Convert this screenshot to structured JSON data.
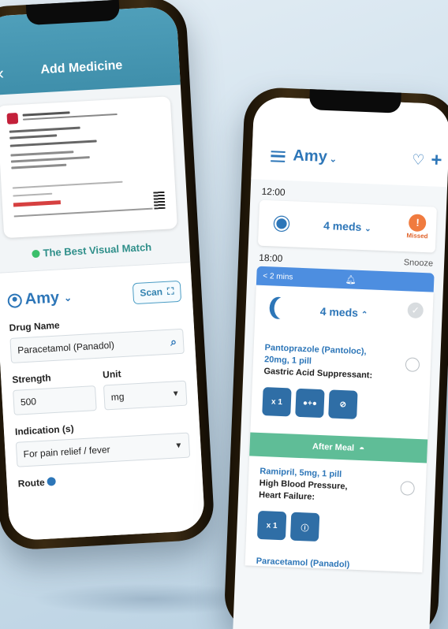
{
  "left_phone": {
    "header": {
      "back_icon": "chevron-left-icon",
      "title": "Add Medicine"
    },
    "match_label": "The Best Visual Match",
    "form": {
      "user_name": "Amy",
      "scan_label": "Scan",
      "drug_name_label": "Drug Name",
      "drug_name_value": "Paracetamol (Panadol)",
      "strength_label": "Strength",
      "strength_value": "500",
      "unit_label": "Unit",
      "unit_value": "mg",
      "indication_label": "Indication (s)",
      "indication_value": "For pain relief / fever",
      "route_label": "Route"
    }
  },
  "right_phone": {
    "header": {
      "user_name": "Amy",
      "plus_label": "+"
    },
    "slots": [
      {
        "time": "12:00",
        "meds_label": "4 meds",
        "status": "Missed",
        "status_symbol": "!"
      },
      {
        "time": "18:00",
        "snooze_label": "Snooze",
        "alert_text": "< 2 mins",
        "meds_label": "4 meds"
      }
    ],
    "medications": [
      {
        "name": "Pantoprazole (Pantoloc), 20mg, 1 pill",
        "description": "Gastric Acid Suppressant:",
        "chips": [
          "x 1",
          "●+●",
          "⊘"
        ]
      },
      {
        "name": "Ramipril, 5mg, 1 pill",
        "description": "High Blood Pressure, Heart Failure:",
        "chips": [
          "x 1",
          "ⓘ"
        ]
      }
    ],
    "meal_label": "After Meal",
    "last_item": "Paracetamol (Panadol)",
    "colors": {
      "primary": "#2d76b8",
      "accent_green": "#5fbd97",
      "missed": "#f07b3f",
      "alert": "#4d8ee0"
    }
  }
}
